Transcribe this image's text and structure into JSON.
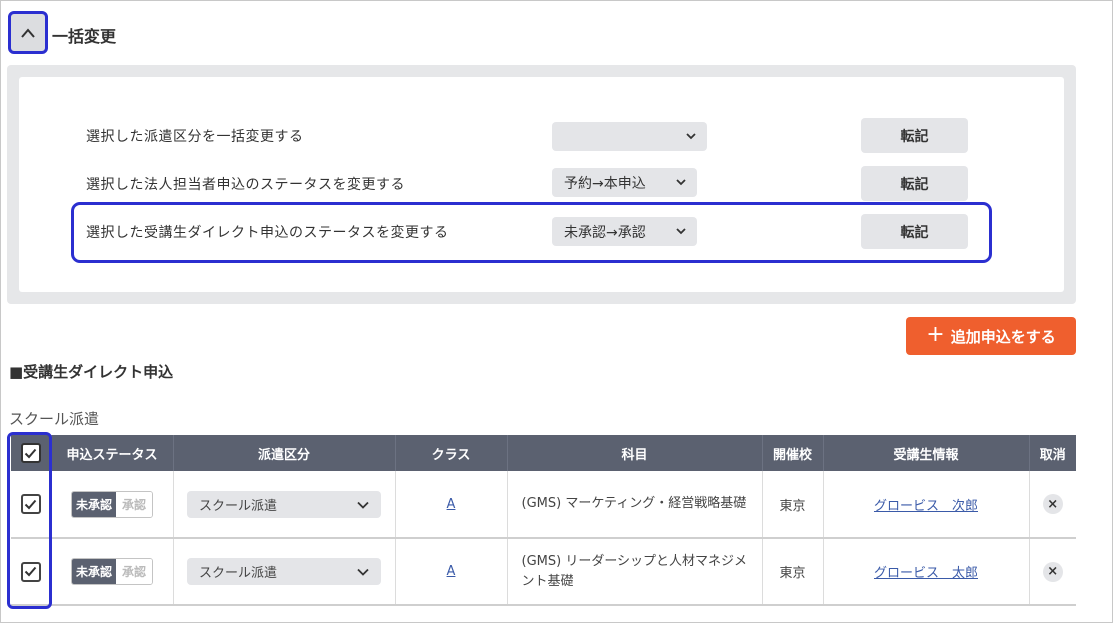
{
  "bulk": {
    "title": "一括変更",
    "rows": [
      {
        "label": "選択した派遣区分を一括変更する",
        "select_value": "",
        "button": "転記"
      },
      {
        "label": "選択した法人担当者申込のステータスを変更する",
        "select_value": "予約→本申込",
        "button": "転記"
      },
      {
        "label": "選択した受講生ダイレクト申込のステータスを変更する",
        "select_value": "未承認→承認",
        "button": "転記"
      }
    ]
  },
  "add_button": {
    "plus": "+",
    "label": "追加申込をする"
  },
  "section": {
    "heading": "■受講生ダイレクト申込",
    "school_label": "スクール派遣"
  },
  "table": {
    "headers": [
      "",
      "申込ステータス",
      "派遣区分",
      "クラス",
      "科目",
      "開催校",
      "受講生情報",
      "取消"
    ],
    "rows": [
      {
        "status_on": "未承認",
        "status_off": "承認",
        "dispatch": "スクール派遣",
        "class": "A",
        "subject": "(GMS) マーケティング・経営戦略基礎",
        "school": "東京",
        "student": "グロービス　次郎",
        "cancel": "×"
      },
      {
        "status_on": "未承認",
        "status_off": "承認",
        "dispatch": "スクール派遣",
        "class": "A",
        "subject": "(GMS) リーダーシップと人材マネジメント基礎",
        "school": "東京",
        "student": "グロービス　太郎",
        "cancel": "×"
      }
    ]
  },
  "colors": {
    "accent_outline": "#2b2fd0",
    "add_button": "#ef5f2e",
    "table_header": "#5b6170"
  }
}
